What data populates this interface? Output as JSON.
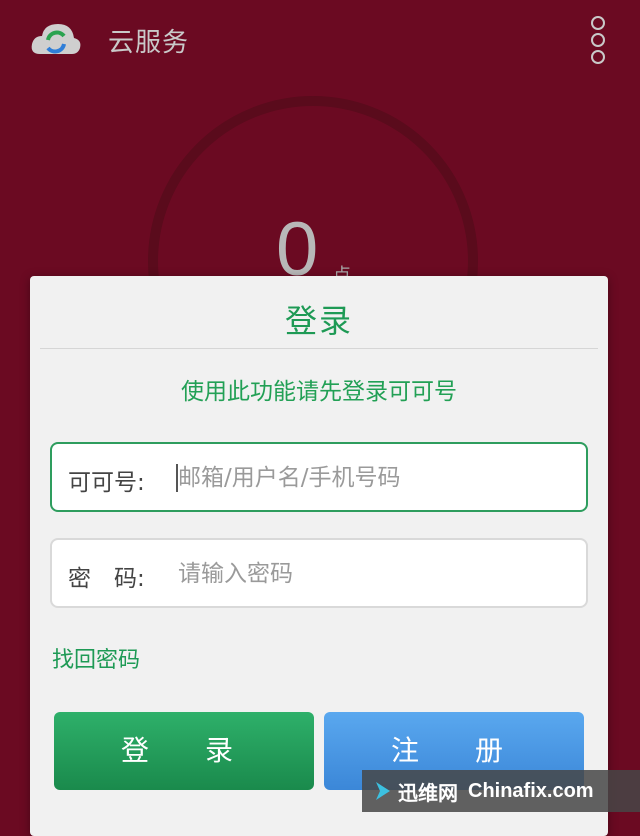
{
  "appbar": {
    "title": "云服务",
    "logo_icon": "cloud-sync-icon",
    "menu_icon": "more-vertical-icon"
  },
  "score": {
    "value": "0",
    "unit": "点"
  },
  "dialog": {
    "title": "登录",
    "hint": "使用此功能请先登录可可号",
    "account_field": {
      "label": "可可号:",
      "placeholder": "邮箱/用户名/手机号码",
      "value": ""
    },
    "password_field": {
      "label": "密　码:",
      "placeholder": "请输入密码",
      "value": ""
    },
    "forgot_password": "找回密码",
    "login_button": "登　录",
    "register_button": "注　册"
  },
  "watermark": {
    "cn": "迅维网",
    "en": "Chinafix.com"
  },
  "colors": {
    "background": "#6b0a22",
    "accent_green": "#1e9a55",
    "login_button": "#24a05c",
    "register_button": "#4a98e4",
    "dialog": "#f1f1f1"
  }
}
